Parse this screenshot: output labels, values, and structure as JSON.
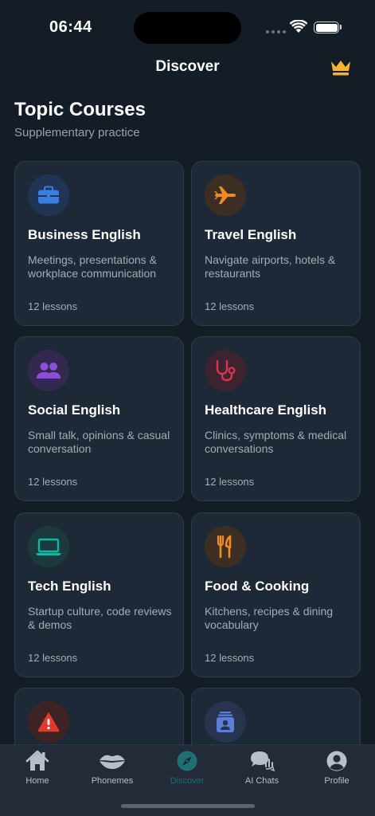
{
  "status_bar": {
    "time": "06:44"
  },
  "header": {
    "title": "Discover",
    "premium_icon": "crown-icon"
  },
  "section": {
    "title": "Topic Courses",
    "subtitle": "Supplementary practice"
  },
  "colors": {
    "background": "#141c25",
    "card": "#1e2937",
    "active_tab": "#1e6f73",
    "crown": "#f5b431"
  },
  "courses": [
    {
      "title": "Business English",
      "description": "Meetings, presentations & workplace communication",
      "lessons": "12 lessons",
      "icon": "briefcase-icon",
      "color": "#3a7fe0"
    },
    {
      "title": "Travel English",
      "description": "Navigate airports, hotels & restaurants",
      "lessons": "12 lessons",
      "icon": "airplane-icon",
      "color": "#f08a24"
    },
    {
      "title": "Social English",
      "description": "Small talk, opinions & casual conversation",
      "lessons": "12 lessons",
      "icon": "people-icon",
      "color": "#8b4fd8"
    },
    {
      "title": "Healthcare English",
      "description": "Clinics, symptoms & medical conversations",
      "lessons": "12 lessons",
      "icon": "stethoscope-icon",
      "color": "#d9344f"
    },
    {
      "title": "Tech English",
      "description": "Startup culture, code reviews & demos",
      "lessons": "12 lessons",
      "icon": "laptop-icon",
      "color": "#19b3a6"
    },
    {
      "title": "Food & Cooking",
      "description": "Kitchens, recipes & dining vocabulary",
      "lessons": "12 lessons",
      "icon": "fork-knife-icon",
      "color": "#f08a24"
    },
    {
      "title": "",
      "description": "",
      "lessons": "",
      "icon": "warning-icon",
      "color": "#e23a2e"
    },
    {
      "title": "",
      "description": "",
      "lessons": "",
      "icon": "contact-card-icon",
      "color": "#5b7fd6"
    }
  ],
  "tabs": [
    {
      "label": "Home",
      "icon": "house-icon"
    },
    {
      "label": "Phonemes",
      "icon": "lips-icon"
    },
    {
      "label": "Discover",
      "icon": "compass-icon",
      "active": true
    },
    {
      "label": "AI Chats",
      "icon": "chat-bubbles-icon"
    },
    {
      "label": "Profile",
      "icon": "person-icon"
    }
  ]
}
